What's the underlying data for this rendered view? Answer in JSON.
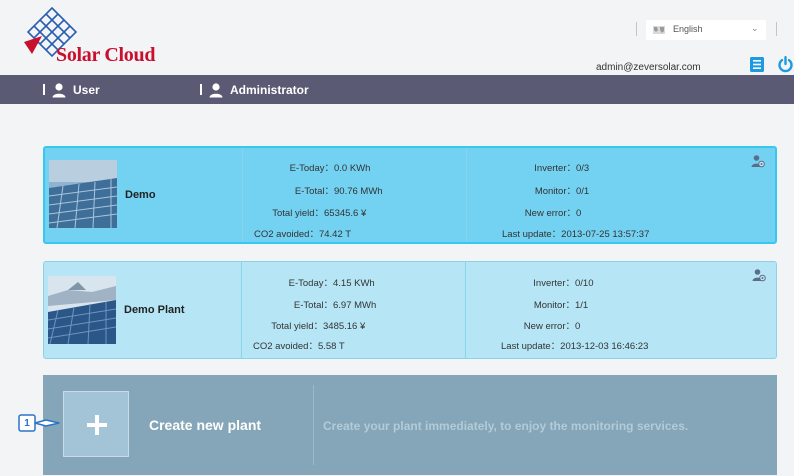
{
  "header": {
    "logo_text": "Solar Cloud",
    "language": "English",
    "email": "admin@zeversolar.com"
  },
  "nav": {
    "user_label": "User",
    "admin_label": "Administrator"
  },
  "plants": [
    {
      "name": "Demo",
      "e_today_label": "E-Today：",
      "e_today": "0.0 KWh",
      "e_total_label": "E-Total：",
      "e_total": "90.76 MWh",
      "total_yield_label": "Total yield：",
      "total_yield": "65345.6 ¥",
      "co2_label": "CO2 avoided：",
      "co2": "74.42 T",
      "inverter_label": "Inverter：",
      "inverter": "0/3",
      "monitor_label": "Monitor：",
      "monitor": "0/1",
      "new_error_label": "New error：",
      "new_error": "0",
      "last_update_label": "Last update：",
      "last_update": "2013-07-25 13:57:37"
    },
    {
      "name": "Demo Plant",
      "e_today_label": "E-Today：",
      "e_today": "4.15 KWh",
      "e_total_label": "E-Total：",
      "e_total": "6.97 MWh",
      "total_yield_label": "Total yield：",
      "total_yield": "3485.16 ¥",
      "co2_label": "CO2 avoided：",
      "co2": "5.58 T",
      "inverter_label": "Inverter：",
      "inverter": "0/10",
      "monitor_label": "Monitor：",
      "monitor": "1/1",
      "new_error_label": "New error：",
      "new_error": "0",
      "last_update_label": "Last update：",
      "last_update": "2013-12-03 16:46:23"
    }
  ],
  "create": {
    "label": "Create new plant",
    "description": "Create your plant immediately, to enjoy the monitoring services."
  },
  "callout_number": "1",
  "colors": {
    "brand_red": "#c8102e",
    "logo_blue": "#2a5fb0",
    "navbar": "#5a5a74",
    "card_active": "#73d1f1",
    "card_normal": "#b6e6f6",
    "create_panel": "#85a6b8",
    "icon_blue": "#1e9be0"
  },
  "icons": [
    "logo-grid-icon",
    "globe-icon",
    "chevron-down-icon",
    "list-icon",
    "power-icon",
    "user-icon",
    "settings-icon",
    "plus-icon"
  ]
}
